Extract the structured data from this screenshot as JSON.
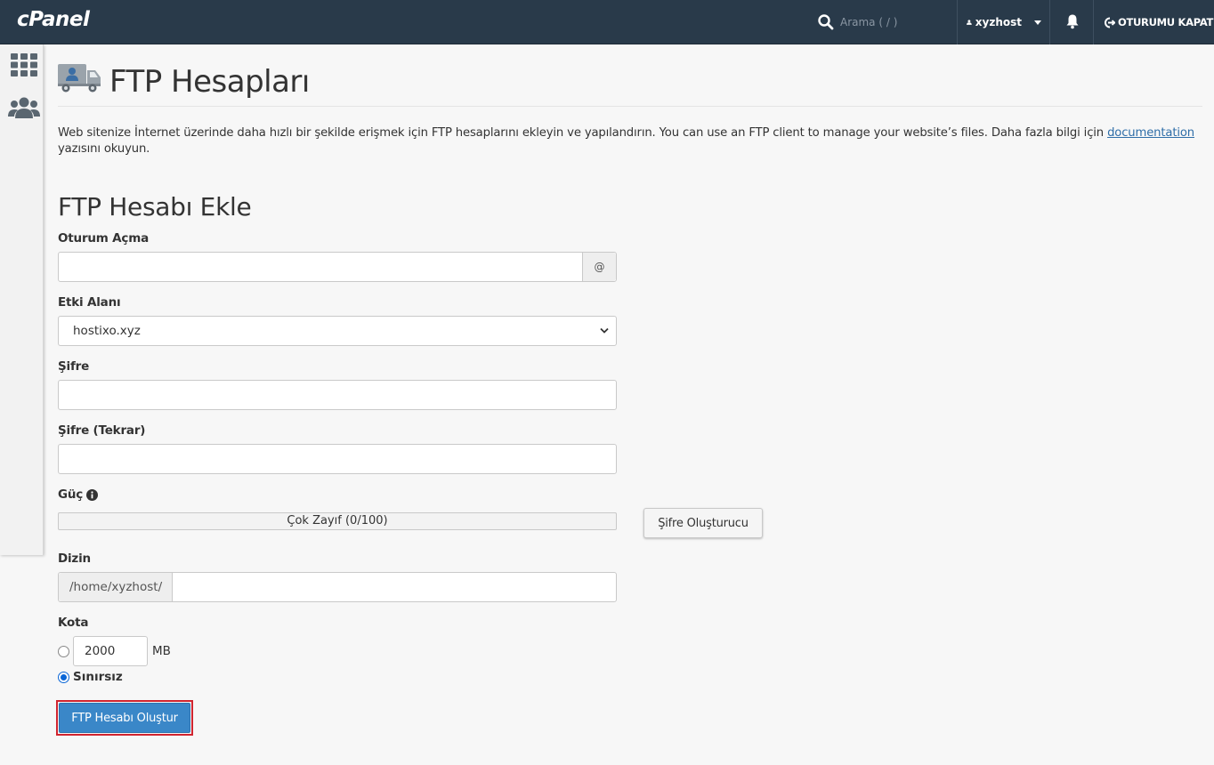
{
  "topbar": {
    "logo": "cPanel",
    "search_placeholder": "Arama ( / )",
    "username": "xyzhost",
    "logout_label": "OTURUMU KAPAT"
  },
  "page": {
    "title": "FTP Hesapları",
    "intro_text": "Web sitenize İnternet üzerinde daha hızlı bir şekilde erişmek için FTP hesaplarını ekleyin ve yapılandırın. You can use an FTP client to manage your website’s files. Daha fazla bilgi için ",
    "intro_link": "documentation",
    "intro_suffix": "yazısını okuyun."
  },
  "form": {
    "section_title": "FTP Hesabı Ekle",
    "login_label": "Oturum Açma",
    "login_value": "",
    "at_symbol": "@",
    "domain_label": "Etki Alanı",
    "domain_selected": "hostixo.xyz",
    "password_label": "Şifre",
    "password_confirm_label": "Şifre (Tekrar)",
    "strength_label": "Güç",
    "strength_text": "Çok Zayıf (0/100)",
    "strength_value": 0,
    "generator_button": "Şifre Oluşturucu",
    "directory_label": "Dizin",
    "directory_prefix": "/home/xyzhost/",
    "directory_value": "",
    "quota_label": "Kota",
    "quota_value": "2000",
    "quota_unit": "MB",
    "unlimited_label": "Sınırsız",
    "unlimited_selected": true,
    "submit_button": "FTP Hesabı Oluştur"
  },
  "colors": {
    "topbar": "#293a4a",
    "primary_button": "#3a87c8",
    "highlight_border": "#d0242f",
    "link": "#2f6ea8"
  }
}
